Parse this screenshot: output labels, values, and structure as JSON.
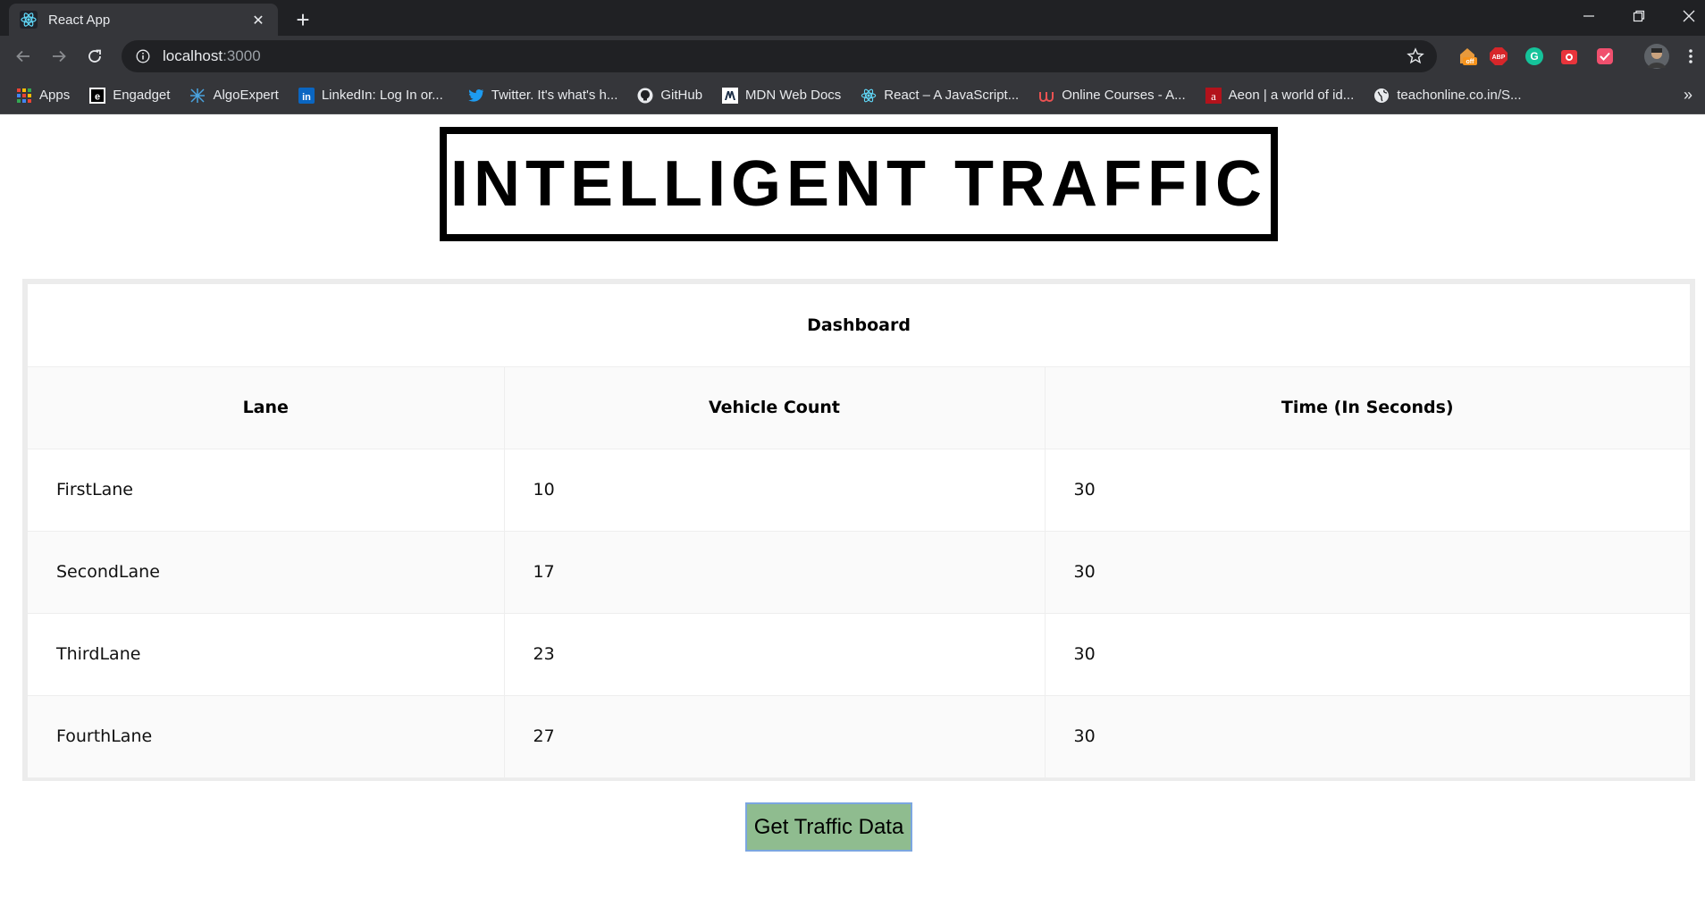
{
  "browser": {
    "tab": {
      "title": "React App"
    },
    "url": {
      "host": "localhost",
      "port": ":3000"
    },
    "bookmarks": [
      {
        "label": "Apps",
        "icon": "apps-grid-icon"
      },
      {
        "label": "Engadget",
        "icon": "engadget-icon"
      },
      {
        "label": "AlgoExpert",
        "icon": "algoexpert-icon"
      },
      {
        "label": "LinkedIn: Log In or...",
        "icon": "linkedin-icon"
      },
      {
        "label": "Twitter. It's what's h...",
        "icon": "twitter-icon"
      },
      {
        "label": "GitHub",
        "icon": "github-icon"
      },
      {
        "label": "MDN Web Docs",
        "icon": "mdn-icon"
      },
      {
        "label": "React – A JavaScript...",
        "icon": "react-icon"
      },
      {
        "label": "Online Courses - A...",
        "icon": "udemy-icon"
      },
      {
        "label": "Aeon | a world of id...",
        "icon": "aeon-icon"
      },
      {
        "label": "teachonline.co.in/S...",
        "icon": "globe-icon"
      }
    ],
    "bookmarks_more": "»",
    "extensions": [
      "honey-icon",
      "adblock-icon",
      "grammarly-icon",
      "extension-icon",
      "timer-icon"
    ],
    "colors": {
      "chrome_dark": "#202124",
      "chrome_mid": "#35363a",
      "text": "#e8eaed"
    }
  },
  "page": {
    "title": "INTELLIGENT TRAFFIC",
    "dashboard": {
      "caption": "Dashboard",
      "columns": [
        "Lane",
        "Vehicle Count",
        "Time (In Seconds)"
      ],
      "rows": [
        {
          "lane": "FirstLane",
          "count": "10",
          "time": "30"
        },
        {
          "lane": "SecondLane",
          "count": "17",
          "time": "30"
        },
        {
          "lane": "ThirdLane",
          "count": "23",
          "time": "30"
        },
        {
          "lane": "FourthLane",
          "count": "27",
          "time": "30"
        }
      ]
    },
    "button_label": "Get Traffic Data",
    "colors": {
      "button_bg": "#8fbc8f",
      "button_border": "#7ba6e0"
    }
  }
}
